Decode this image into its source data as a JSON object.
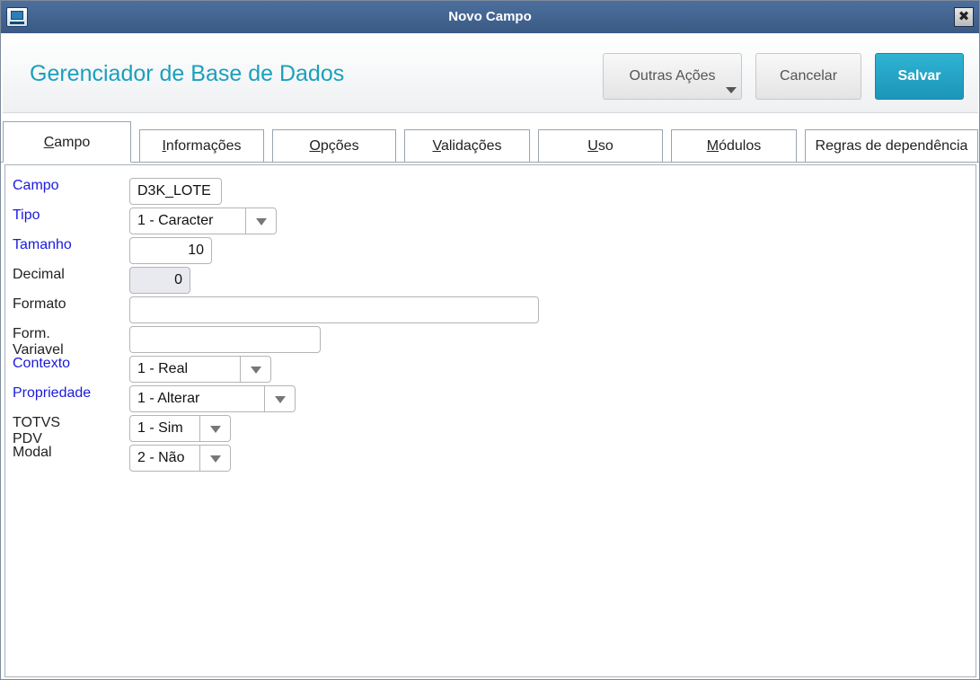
{
  "window": {
    "title": "Novo Campo",
    "close_glyph": "✖"
  },
  "header": {
    "title": "Gerenciador de Base de Dados",
    "outras_label": "Outras Ações",
    "cancelar_label": "Cancelar",
    "salvar_label": "Salvar"
  },
  "tabs": [
    {
      "label": "Campo",
      "mnemonic": "C",
      "rest": "ampo"
    },
    {
      "label": "Informações",
      "mnemonic": "I",
      "rest": "nformações"
    },
    {
      "label": "Opções",
      "mnemonic": "O",
      "rest": "pções"
    },
    {
      "label": "Validações",
      "mnemonic": "V",
      "rest": "alidações"
    },
    {
      "label": "Uso",
      "mnemonic": "U",
      "rest": "so"
    },
    {
      "label": "Módulos",
      "mnemonic": "M",
      "rest": "ódulos"
    },
    {
      "label": "Regras de dependência",
      "mnemonic": "",
      "rest": "Regras de dependência"
    }
  ],
  "form": {
    "campo": {
      "label": "Campo",
      "value": "D3K_LOTE"
    },
    "tipo": {
      "label": "Tipo",
      "value": "1 - Caracter"
    },
    "tamanho": {
      "label": "Tamanho",
      "value": "10"
    },
    "decimal": {
      "label": "Decimal",
      "value": "0"
    },
    "formato": {
      "label": "Formato",
      "value": ""
    },
    "form_variavel": {
      "label": "Form. Variavel",
      "value": ""
    },
    "contexto": {
      "label": "Contexto",
      "value": "1 - Real"
    },
    "propriedade": {
      "label": "Propriedade",
      "value": "1 - Alterar"
    },
    "totvs_pdv": {
      "label": "TOTVS PDV",
      "value": "1 - Sim"
    },
    "modal": {
      "label": "Modal",
      "value": "2 - Não"
    }
  },
  "colors": {
    "accent": "#1aa0bd",
    "primary_button": "#1c95b8",
    "required_label": "#1a1add",
    "titlebar": "#3f6090"
  },
  "icons": {
    "app": "monitor-app-icon",
    "close": "close-icon",
    "dropdown": "dropdown-arrow-icon"
  }
}
